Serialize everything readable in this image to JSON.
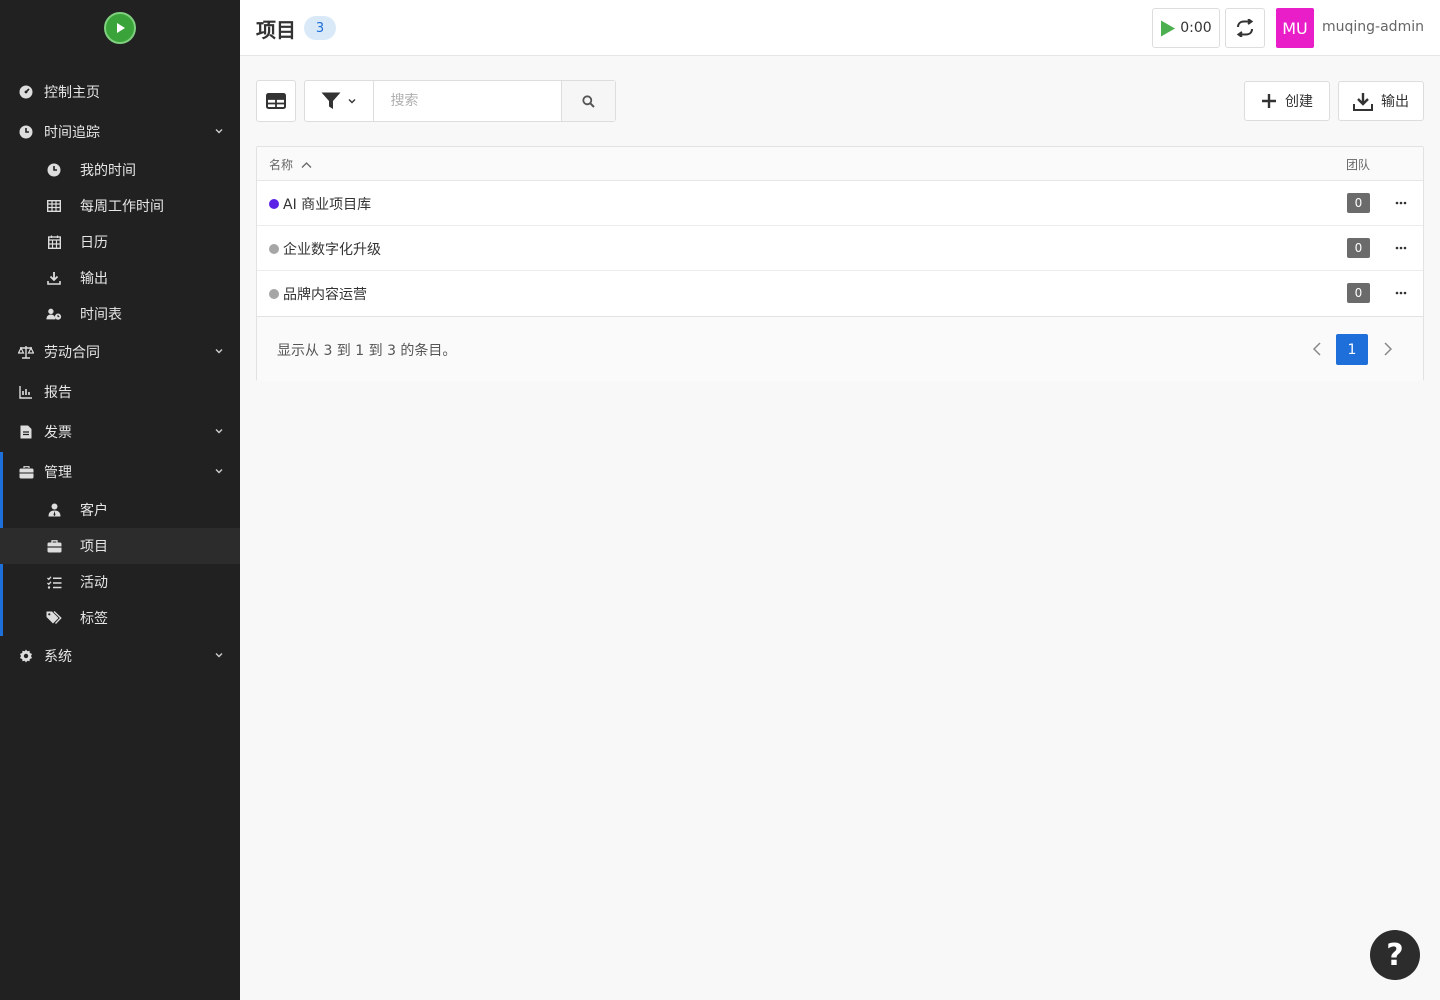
{
  "colors": {
    "accent": "#1e6fd9",
    "sidebar_bg": "#212121",
    "avatar_bg": "#e91ec9",
    "timer_play": "#4caf50"
  },
  "sidebar": {
    "logo": "play-logo-icon",
    "items": {
      "dashboard": {
        "label": "控制主页",
        "icon": "dashboard-icon"
      },
      "timesheet": {
        "label": "时间追踪",
        "icon": "clock-icon"
      },
      "my_time": {
        "label": "我的时间",
        "icon": "clock-icon"
      },
      "weekly": {
        "label": "每周工作时间",
        "icon": "table-grid-icon"
      },
      "calendar": {
        "label": "日历",
        "icon": "calendar-icon"
      },
      "export": {
        "label": "输出",
        "icon": "download-icon"
      },
      "timetable": {
        "label": "时间表",
        "icon": "user-clock-icon"
      },
      "contract": {
        "label": "劳动合同",
        "icon": "balance-scale-icon"
      },
      "reports": {
        "label": "报告",
        "icon": "chart-icon"
      },
      "invoices": {
        "label": "发票",
        "icon": "file-invoice-icon"
      },
      "admin": {
        "label": "管理",
        "icon": "toolbox-icon"
      },
      "customers": {
        "label": "客户",
        "icon": "user-tie-icon"
      },
      "projects": {
        "label": "项目",
        "icon": "briefcase-icon"
      },
      "activities": {
        "label": "活动",
        "icon": "tasks-icon"
      },
      "tags": {
        "label": "标签",
        "icon": "tags-icon"
      },
      "system": {
        "label": "系统",
        "icon": "cog-icon"
      }
    }
  },
  "header": {
    "title": "项目",
    "count": "3",
    "timer": "0:00",
    "avatar_initials": "MU",
    "username": "muqing-admin"
  },
  "toolbar": {
    "search_placeholder": "搜索",
    "create_label": "创建",
    "export_label": "输出"
  },
  "table": {
    "columns": {
      "name": "名称",
      "team": "团队"
    },
    "rows": [
      {
        "name": "AI 商业项目库",
        "team": "0",
        "dot_color": "#5b21e6"
      },
      {
        "name": "企业数字化升级",
        "team": "0",
        "dot_color": "#a6a6a6"
      },
      {
        "name": "品牌内容运营",
        "team": "0",
        "dot_color": "#a6a6a6"
      }
    ],
    "footer_info": "显示从 3 到 1 到 3 的条目。",
    "current_page": "1"
  },
  "help": {
    "label": "?"
  }
}
